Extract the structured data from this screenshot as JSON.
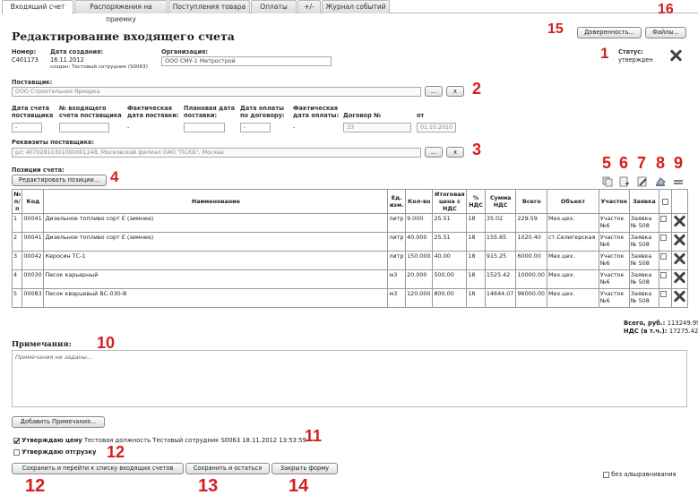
{
  "tabs": [
    "Входящий счет",
    "Распоряжения на приемку",
    "Поступления товара",
    "Оплаты",
    "+/-",
    "Журнал событий"
  ],
  "page_title": "Редактирование входящего счета",
  "header": {
    "number_label": "Номер:",
    "number_value": "С401173",
    "created_label": "Дата создания:",
    "created_value": "16.11.2012",
    "created_by": "создан: Тестовый сотрудник (S0063)",
    "org_label": "Организация:",
    "org_value": "ООО СМУ-1 Метрострой",
    "status_label": "Статус:",
    "status_value": "утвержден"
  },
  "buttons": {
    "power_of_attorney": "Доверенность...",
    "files": "Файлы...",
    "dots": "...",
    "clear": "x",
    "edit_positions": "Редактировать позиции...",
    "add_notes": "Добавить Примечания...",
    "save_go_list": "Сохранить и перейти к списку входящих счетов",
    "save_stay": "Сохранить и остаться",
    "close_form": "Закрыть форму"
  },
  "supplier": {
    "label": "Поставщик:",
    "value": "ООО Строительная Ярмарка"
  },
  "dates": {
    "h1": "Дата счета поставщика",
    "h2": "№ входящего счета поставщика",
    "h3": "Фактическая дата поставки:",
    "h4": "Плановая дата поставки:",
    "h5": "Дата оплаты по договору:",
    "h6": "Фактическая дата оплаты:",
    "h7": "Договор №",
    "h8": "от",
    "v1": "-",
    "v3": "-",
    "v5": "-",
    "v6": "-",
    "v7": "33",
    "v8": "01.10.2010"
  },
  "requisites": {
    "label": "Реквизиты поставщика:",
    "value": "р/с 40702810301000001248, Московский филиал ОАО \"ПСКБ\", Москва"
  },
  "positions_label": "Позиции счета:",
  "table": {
    "headers": [
      "№ п/п",
      "Код",
      "Наименование",
      "Ед. изм.",
      "Кол-во",
      "Итоговая цена с НДС",
      "% НДС",
      "Сумма НДС",
      "Всего",
      "Объект",
      "Участок",
      "Заявка"
    ],
    "rows": [
      [
        "1",
        "00041",
        "Дизельное топливо сорт Е (зимнее)",
        "литр",
        "9.000",
        "25.51",
        "18",
        "35.02",
        "229.59",
        "Мех.цех.",
        "Участок №6",
        "Заявка № 508"
      ],
      [
        "2",
        "00041",
        "Дизельное топливо сорт Е (зимнее)",
        "литр",
        "40.000",
        "25.51",
        "18",
        "155.65",
        "1020.40",
        "ст.Селигерская",
        "Участок №6",
        "Заявка № 508"
      ],
      [
        "3",
        "00042",
        "Керосин ТС-1",
        "литр",
        "150.000",
        "40.00",
        "18",
        "915.25",
        "6000.00",
        "Мех.цех.",
        "Участок №6",
        "Заявка № 508"
      ],
      [
        "4",
        "00030",
        "Песок карьерный",
        "м3",
        "20.000",
        "500.00",
        "18",
        "1525.42",
        "10000.00",
        "Мех.цех.",
        "Участок №6",
        "Заявка № 508"
      ],
      [
        "5",
        "00083",
        "Песок кварцевый ВС-030-В",
        "м3",
        "120.000",
        "800.00",
        "18",
        "14644.07",
        "96000.00",
        "Мех.цех.",
        "Участок №6",
        "Заявка № 508"
      ]
    ]
  },
  "totals": {
    "total_label": "Всего, руб.:",
    "total_value": "113249.99",
    "vat_label": "НДС (в т.ч.):",
    "vat_value": "17275.42"
  },
  "notes": {
    "label": "Примечания:",
    "placeholder": "Примечания не заданы..."
  },
  "approve": {
    "price_label": "Утверждаю цену",
    "price_info": "Тестовая должность Тестовый сотрудник S0063 18.11.2012 13:53:59",
    "shipment_label": "Утверждаю отгрузку",
    "no_adjust_label": "без а/выравнивания"
  },
  "markers": {
    "m1": "1",
    "m2": "2",
    "m3": "3",
    "m4": "4",
    "m5": "5",
    "m6": "6",
    "m7": "7",
    "m8": "8",
    "m9": "9",
    "m10": "10",
    "m11": "11",
    "m12a": "12",
    "m12b": "12",
    "m13": "13",
    "m14": "14",
    "m15": "15",
    "m16": "16"
  },
  "colors": {
    "marker": "#d81c1c",
    "tab_border": "#b9b9b9"
  }
}
